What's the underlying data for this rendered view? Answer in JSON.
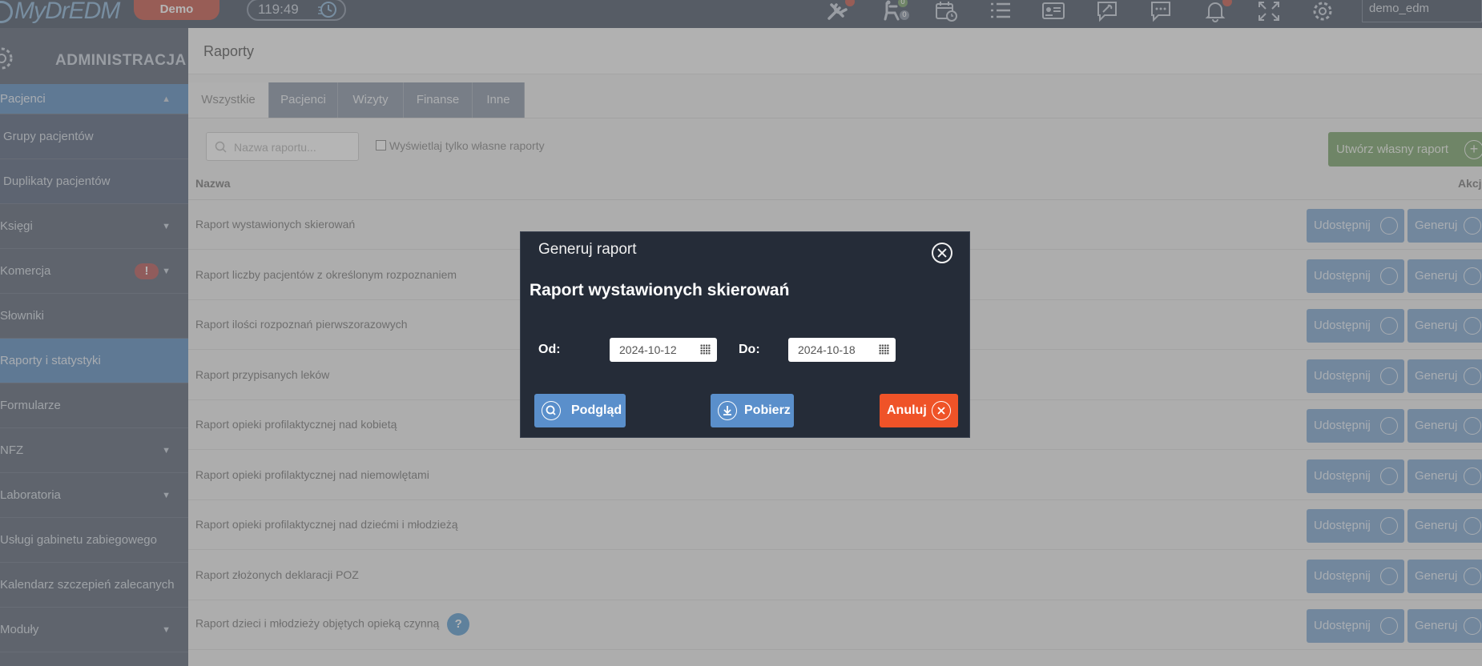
{
  "topbar": {
    "logo_text": "MyDrEDM",
    "demo_label": "Demo",
    "timer": "119:49",
    "notif_badges": [
      "0",
      "0"
    ],
    "username": "demo_edm",
    "icons": [
      "tools-icon",
      "patient-chair-icon",
      "calendar-clock-icon",
      "list-icon",
      "id-card-icon",
      "settings-chat-icon",
      "chat-icon",
      "bell-icon",
      "fullscreen-icon",
      "gear-icon"
    ]
  },
  "sidebar": {
    "title": "ADMINISTRACJA",
    "items": [
      {
        "label": "Pacjenci",
        "arrow": "▲",
        "state": "active"
      },
      {
        "label": "Grupy pacjentów",
        "arrow": "",
        "state": "sub"
      },
      {
        "label": "Duplikaty pacjentów",
        "arrow": "",
        "state": "sub"
      },
      {
        "label": "Księgi",
        "arrow": "▼",
        "state": ""
      },
      {
        "label": "Komercja",
        "arrow": "▼",
        "state": "",
        "warn": "!"
      },
      {
        "label": "Słowniki",
        "arrow": "",
        "state": ""
      },
      {
        "label": "Raporty i statystyki",
        "arrow": "",
        "state": "active"
      },
      {
        "label": "Formularze",
        "arrow": "",
        "state": ""
      },
      {
        "label": "NFZ",
        "arrow": "▼",
        "state": ""
      },
      {
        "label": "Laboratoria",
        "arrow": "▼",
        "state": ""
      },
      {
        "label": "Usługi gabinetu zabiegowego",
        "arrow": "",
        "state": ""
      },
      {
        "label": "Kalendarz szczepień zalecanych",
        "arrow": "",
        "state": ""
      },
      {
        "label": "Moduły",
        "arrow": "▼",
        "state": ""
      }
    ]
  },
  "main": {
    "page_title": "Raporty",
    "tabs": [
      "Wszystkie",
      "Pacjenci",
      "Wizyty",
      "Finanse",
      "Inne"
    ],
    "search_placeholder": "Nazwa raportu...",
    "own_only_label": "Wyświetlaj tylko własne raporty",
    "create_button": "Utwórz własny raport",
    "col_name": "Nazwa",
    "col_actions": "Akcje",
    "share_label": "Udostępnij",
    "generate_label": "Generuj",
    "help_label": "?",
    "rows": [
      "Raport wystawionych skierowań",
      "Raport liczby pacjentów z określonym rozpoznaniem",
      "Raport ilości rozpoznań pierwszorazowych",
      "Raport przypisanych leków",
      "Raport opieki profilaktycznej nad kobietą",
      "Raport opieki profilaktycznej nad niemowlętami",
      "Raport opieki profilaktycznej nad dziećmi i młodzieżą",
      "Raport złożonych deklaracji POZ",
      "Raport dzieci i młodzieży objętych opieką czynną"
    ]
  },
  "modal": {
    "title": "Generuj raport",
    "subtitle": "Raport wystawionych skierowań",
    "from_label": "Od:",
    "from_value": "2024-10-12",
    "to_label": "Do:",
    "to_value": "2024-10-18",
    "preview_button": "Podgląd",
    "download_button": "Pobierz",
    "cancel_button": "Anuluj"
  },
  "colors": {
    "topbar": "#4a5566",
    "sidebar": "#5a6575",
    "sidebar_active": "#5b8cc0",
    "modal_bg": "#252c38",
    "primary_button": "#5a8fcb",
    "cancel_button": "#ef5328",
    "create_button": "#7aa36a",
    "demo_badge": "#c7574a"
  }
}
